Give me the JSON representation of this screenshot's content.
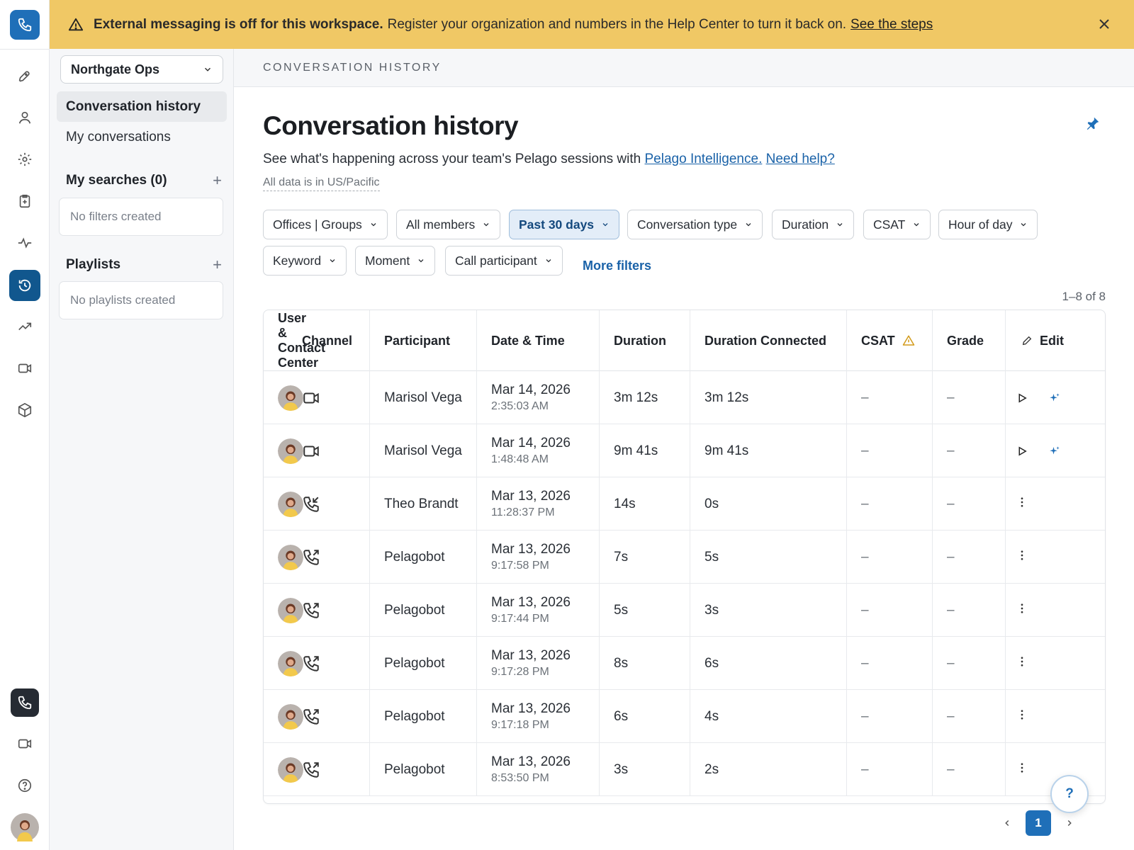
{
  "banner": {
    "bold": "External messaging is off for this workspace.",
    "text": "Register your organization and numbers in the Help Center to turn it back on.",
    "link": "See the steps"
  },
  "sidebar": {
    "workspace": "Northgate Ops",
    "nav": [
      "Conversation history",
      "My conversations"
    ],
    "searches_title": "My searches (0)",
    "searches_empty": "No filters created",
    "playlists_title": "Playlists",
    "playlists_empty": "No playlists created"
  },
  "breadcrumb": "CONVERSATION HISTORY",
  "page": {
    "title": "Conversation history",
    "subtitle": "See what's happening across your team's Pelago sessions with",
    "link1": "Pelago Intelligence.",
    "link2": "Need help?",
    "timezone": "All data is in US/Pacific"
  },
  "filters": [
    "Offices | Groups",
    "All members",
    "Past 30 days",
    "Conversation type",
    "Duration",
    "CSAT",
    "Hour of day",
    "Keyword",
    "Moment",
    "Call participant"
  ],
  "active_filter": "Past 30 days",
  "more_filters": "More filters",
  "result_count": "1–8 of 8",
  "table": {
    "col_user_lines": [
      "User",
      "&",
      "Contact",
      "Center"
    ],
    "col_channel": "Channel",
    "columns": [
      "Participant",
      "Date & Time",
      "Duration",
      "Duration Connected",
      "CSAT",
      "Grade"
    ],
    "edit": "Edit",
    "rows": [
      {
        "channel": "video",
        "participant": "Marisol Vega",
        "date": "Mar 14, 2026",
        "time": "2:35:03 AM",
        "duration": "3m 12s",
        "connected": "3m 12s",
        "csat": "–",
        "grade": "–",
        "actions": "play-sparkle"
      },
      {
        "channel": "video",
        "participant": "Marisol Vega",
        "date": "Mar 14, 2026",
        "time": "1:48:48 AM",
        "duration": "9m 41s",
        "connected": "9m 41s",
        "csat": "–",
        "grade": "–",
        "actions": "play-sparkle"
      },
      {
        "channel": "phone-incoming",
        "participant": "Theo Brandt",
        "date": "Mar 13, 2026",
        "time": "11:28:37 PM",
        "duration": "14s",
        "connected": "0s",
        "csat": "–",
        "grade": "–",
        "actions": "more"
      },
      {
        "channel": "phone-outgoing",
        "participant": "Pelagobot",
        "date": "Mar 13, 2026",
        "time": "9:17:58 PM",
        "duration": "7s",
        "connected": "5s",
        "csat": "–",
        "grade": "–",
        "actions": "more"
      },
      {
        "channel": "phone-outgoing",
        "participant": "Pelagobot",
        "date": "Mar 13, 2026",
        "time": "9:17:44 PM",
        "duration": "5s",
        "connected": "3s",
        "csat": "–",
        "grade": "–",
        "actions": "more"
      },
      {
        "channel": "phone-outgoing",
        "participant": "Pelagobot",
        "date": "Mar 13, 2026",
        "time": "9:17:28 PM",
        "duration": "8s",
        "connected": "6s",
        "csat": "–",
        "grade": "–",
        "actions": "more"
      },
      {
        "channel": "phone-outgoing",
        "participant": "Pelagobot",
        "date": "Mar 13, 2026",
        "time": "9:17:18 PM",
        "duration": "6s",
        "connected": "4s",
        "csat": "–",
        "grade": "–",
        "actions": "more"
      },
      {
        "channel": "phone-outgoing",
        "participant": "Pelagobot",
        "date": "Mar 13, 2026",
        "time": "8:53:50 PM",
        "duration": "3s",
        "connected": "2s",
        "csat": "–",
        "grade": "–",
        "actions": "more"
      }
    ]
  },
  "pagination": {
    "current": "1"
  },
  "help_label": "?",
  "colors": {
    "banner": "#f0c865",
    "accent": "#1f6fb8",
    "active_nav": "#11578e"
  }
}
